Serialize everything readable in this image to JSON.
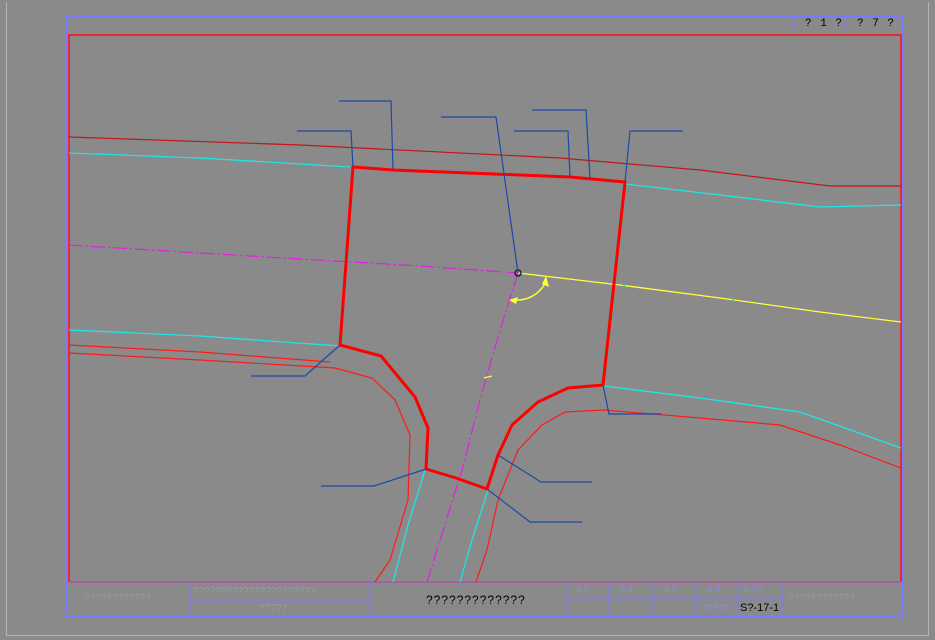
{
  "title_block": {
    "page_a": "? 1 ?",
    "page_b": "? 7 ?",
    "cell_left": "????????????",
    "cell_mid_top": "??????????????????????",
    "cell_mid_bottom": "?????",
    "drawing_title": "?????????????",
    "small_cells": [
      "? ?",
      "? ?",
      "? ?",
      "? ?",
      "? ? ?"
    ],
    "small_cell_bottom": "??? ??",
    "drawing_number": "S?-17-1",
    "cell_right": "????????????"
  },
  "colors": {
    "frame": "#7a7aff",
    "border": "#ff1414",
    "road_edge": "#ff1414",
    "road_edge_dark": "#b01010",
    "curb": "#1ee6e6",
    "centerline": "#e21ee2",
    "survey_line": "#ffff40",
    "leader": "#1a4aa8",
    "boundary": "#ff0000"
  }
}
